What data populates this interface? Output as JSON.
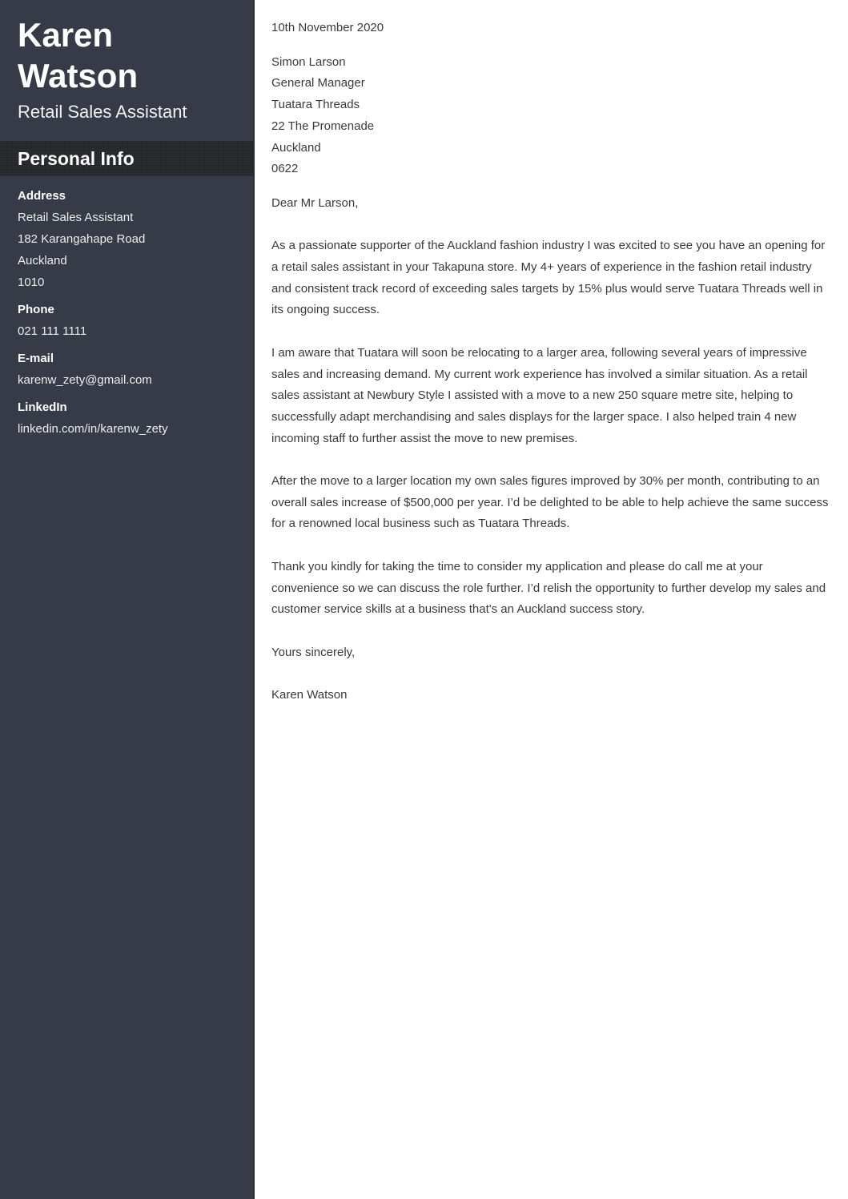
{
  "sidebar": {
    "name_first": "Karen",
    "name_last": "Watson",
    "job_title": "Retail Sales Assistant",
    "section_title": "Personal Info",
    "address": {
      "label": "Address",
      "lines": [
        "Retail Sales Assistant",
        "182 Karangahape Road",
        "Auckland",
        "1010"
      ]
    },
    "phone": {
      "label": "Phone",
      "value": "021 111 1111"
    },
    "email": {
      "label": "E-mail",
      "value": "karenw_zety@gmail.com"
    },
    "linkedin": {
      "label": "LinkedIn",
      "value": "linkedin.com/in/karenw_zety"
    }
  },
  "letter": {
    "date": "10th November 2020",
    "recipient": [
      "Simon Larson",
      "General Manager",
      "Tuatara Threads",
      "22 The Promenade",
      "Auckland",
      "0622"
    ],
    "salutation": "Dear Mr Larson,",
    "paragraphs": [
      "As a passionate supporter of the Auckland fashion industry I was excited to see you have an opening for a retail sales assistant in your Takapuna store. My 4+ years of experience in the fashion retail industry and consistent track record of exceeding sales targets by 15% plus would serve Tuatara Threads well in its ongoing success.",
      "I am aware that Tuatara will soon be relocating to a larger area, following several years of impressive sales and increasing demand. My current work experience has involved a similar situation. As a retail sales assistant at Newbury Style I assisted with a move to a new 250 square metre site, helping to successfully adapt merchandising and sales displays for the larger space. I also helped train 4 new incoming staff to further assist the move to new premises.",
      "After the move to a larger location my own sales figures improved by 30% per month, contributing to an overall sales increase of $500,000 per year. I’d be delighted to be able to help achieve the same success for a renowned local business such as Tuatara Threads.",
      "Thank you kindly for taking the time to consider my application and please do call me at your convenience so we can discuss the role further. I’d relish the opportunity to further develop my sales and customer service skills at a business that's an Auckland success story."
    ],
    "closing": "Yours sincerely,",
    "signature": "Karen Watson"
  }
}
